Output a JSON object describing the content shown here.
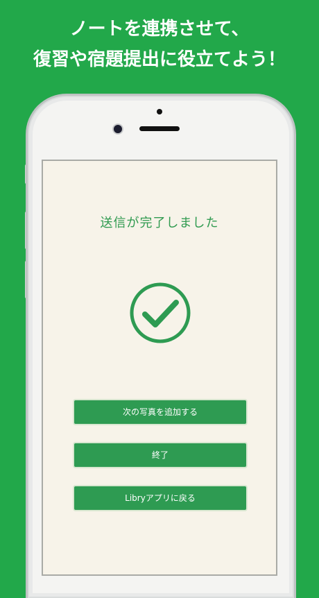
{
  "promo": {
    "line1": "ノートを連携させて、",
    "line2": "復習や宿題提出に役立てよう！"
  },
  "screen": {
    "title": "送信が完了しました",
    "icon": "check-circle-icon",
    "buttons": [
      {
        "label": "次の写真を追加する"
      },
      {
        "label": "終了"
      },
      {
        "label": "Libryアプリに戻る"
      }
    ]
  },
  "colors": {
    "background": "#22a84a",
    "accent": "#2e9b52",
    "screen_bg": "#f7f3e9"
  }
}
